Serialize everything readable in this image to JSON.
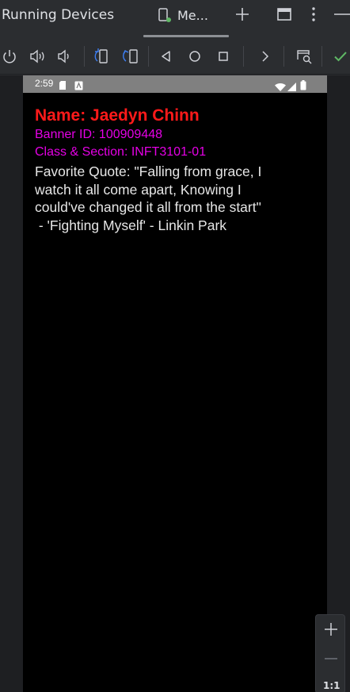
{
  "window": {
    "title": "Running Devices",
    "tab_label": "Me...",
    "colors": {
      "background": "#2b2d30",
      "accent_green": "#5fb865",
      "icon": "#ced0d6"
    }
  },
  "icons": {
    "tab": "phone-icon",
    "add": "plus-icon",
    "maximize": "maximize-icon",
    "more": "more-vert-icon",
    "minimize": "minimize-icon",
    "power": "power-icon",
    "volume_up": "volume-up-icon",
    "volume_down": "volume-down-icon",
    "rotate_left": "rotate-left-icon",
    "rotate_right": "rotate-right-icon",
    "back": "back-triangle-icon",
    "home": "home-circle-icon",
    "overview": "overview-square-icon",
    "more_tools": "chevron-right-icon",
    "screenshot": "screenshot-search-icon",
    "confirm": "checkmark-icon"
  },
  "device": {
    "status_time": "2:59",
    "app": {
      "name_line": "Name: Jaedyn Chinn",
      "banner_line": "Banner ID: 100909448",
      "class_line": "Class & Section: INFT3101-01",
      "quote_lines": [
        "Favorite Quote: \"Falling from grace, I",
        "watch it all come apart, Knowing I",
        "could've changed it all from the start\"",
        " - 'Fighting Myself' - Linkin Park"
      ],
      "colors": {
        "name": "#ff1a1a",
        "info": "#e600e6",
        "quote": "#e6e6e6"
      }
    }
  },
  "zoom": {
    "reset_label": "1:1"
  }
}
